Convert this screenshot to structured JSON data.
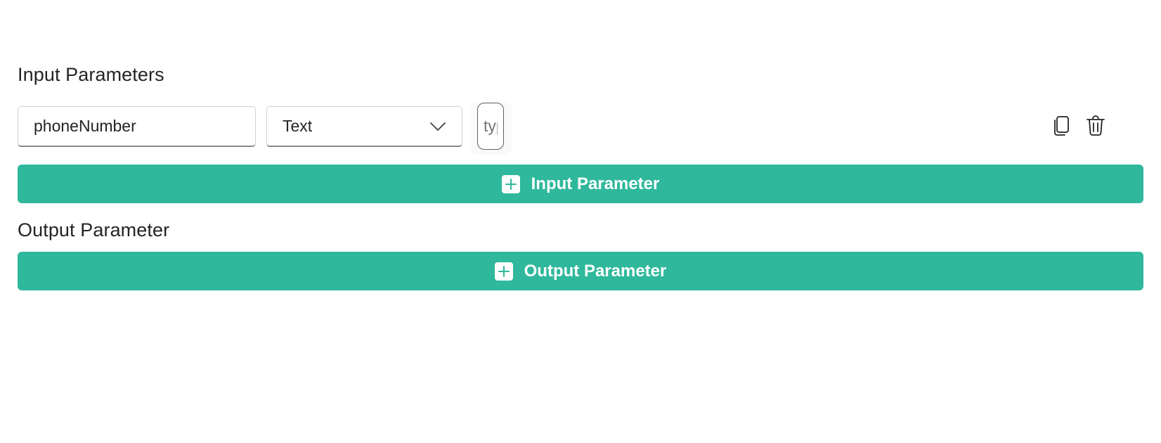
{
  "input_section": {
    "title": "Input Parameters",
    "params": [
      {
        "name_value": "phoneNumber",
        "type_value": "Text",
        "description_placeholder": "type a description"
      }
    ],
    "add_button_label": "Input Parameter"
  },
  "output_section": {
    "title": "Output Parameter",
    "add_button_label": "Output Parameter"
  },
  "icons": {
    "copy": "copy-icon",
    "delete": "trash-icon",
    "plus": "plus-icon",
    "chevron": "chevron-down-icon"
  },
  "colors": {
    "accent": "#2fb89c",
    "text": "#242424",
    "button_text": "#ffffff"
  }
}
